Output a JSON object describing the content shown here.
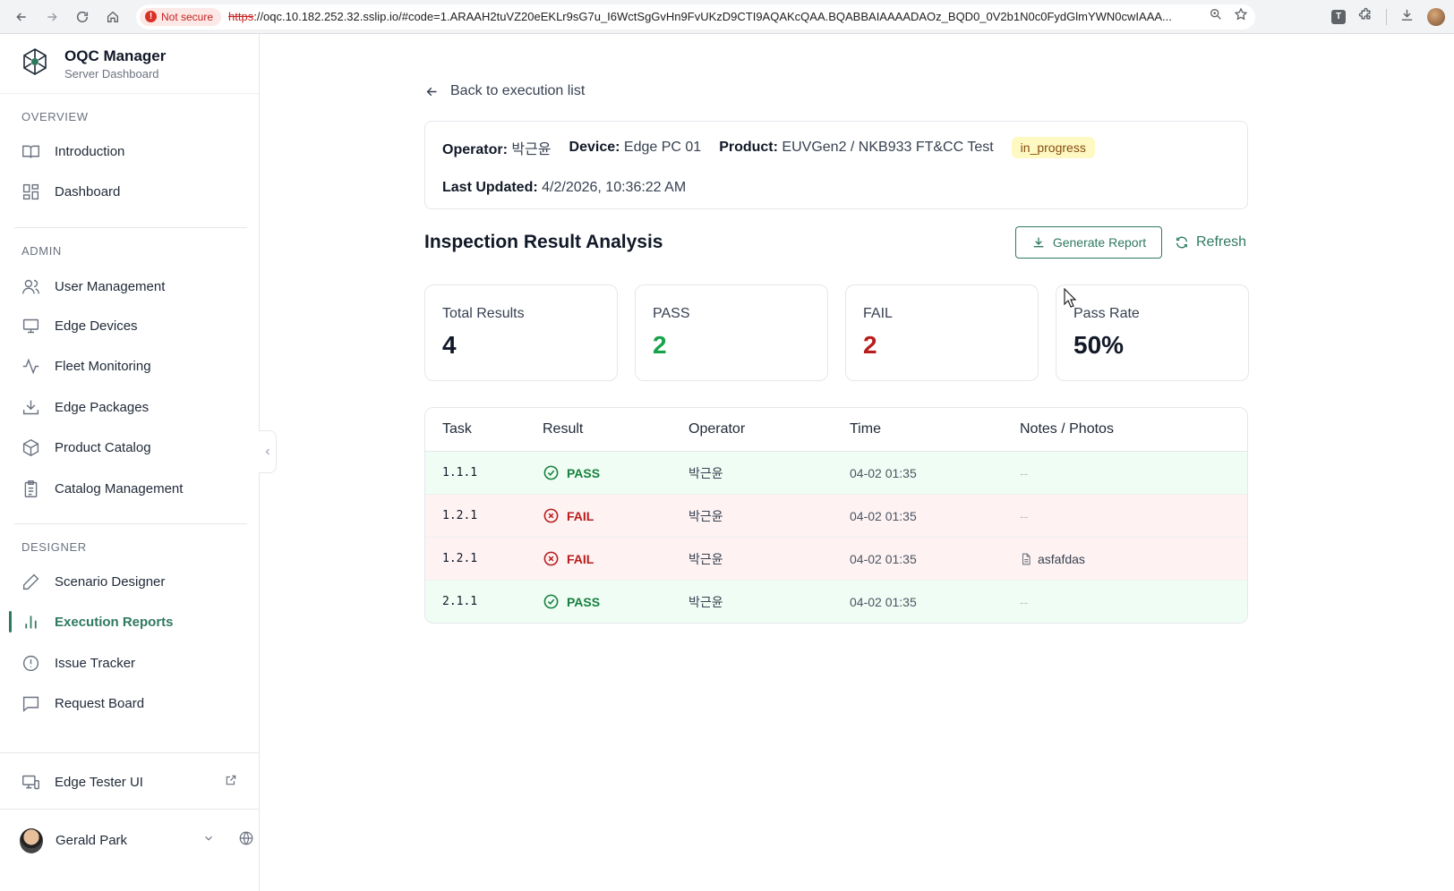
{
  "browser": {
    "not_secure_label": "Not secure",
    "url_scheme": "https",
    "url_rest": "://oqc.10.182.252.32.sslip.io/#code=1.ARAAH2tuVZ20eEKLr9sG7u_I6WctSgGvHn9FvUKzD9CTI9AQAKcQAA.BQABBAIAAAADAOz_BQD0_0V2b1N0c0FydGlmYWN0cwIAAA..."
  },
  "sidebar": {
    "brand_title": "OQC Manager",
    "brand_subtitle": "Server Dashboard",
    "sections": [
      {
        "label": "OVERVIEW",
        "items": [
          {
            "label": "Introduction",
            "icon": "book-icon"
          },
          {
            "label": "Dashboard",
            "icon": "grid-icon"
          }
        ]
      },
      {
        "label": "ADMIN",
        "items": [
          {
            "label": "User Management",
            "icon": "users-icon"
          },
          {
            "label": "Edge Devices",
            "icon": "monitor-icon"
          },
          {
            "label": "Fleet Monitoring",
            "icon": "activity-icon"
          },
          {
            "label": "Edge Packages",
            "icon": "download-tray-icon"
          },
          {
            "label": "Product Catalog",
            "icon": "box-icon"
          },
          {
            "label": "Catalog Management",
            "icon": "clipboard-icon"
          }
        ]
      },
      {
        "label": "DESIGNER",
        "items": [
          {
            "label": "Scenario Designer",
            "icon": "pencil-icon"
          },
          {
            "label": "Execution Reports",
            "icon": "bar-chart-icon",
            "active": true
          },
          {
            "label": "Issue Tracker",
            "icon": "alert-circle-icon"
          },
          {
            "label": "Request Board",
            "icon": "message-square-icon"
          }
        ]
      }
    ],
    "edge_tester_label": "Edge Tester UI",
    "user_name": "Gerald Park"
  },
  "main": {
    "back_label": "Back to execution list",
    "info": {
      "operator_label": "Operator:",
      "operator": "박근윤",
      "device_label": "Device:",
      "device": "Edge PC 01",
      "product_label": "Product:",
      "product": "EUVGen2 / NKB933 FT&CC Test",
      "status": "in_progress",
      "updated_label": "Last Updated:",
      "updated": "4/2/2026, 10:36:22 AM"
    },
    "section_title": "Inspection Result Analysis",
    "generate_report_label": "Generate Report",
    "refresh_label": "Refresh",
    "stats": [
      {
        "label": "Total Results",
        "value": "4"
      },
      {
        "label": "PASS",
        "value": "2"
      },
      {
        "label": "FAIL",
        "value": "2"
      },
      {
        "label": "Pass Rate",
        "value": "50%"
      }
    ],
    "table": {
      "headers": [
        "Task",
        "Result",
        "Operator",
        "Time",
        "Notes / Photos"
      ],
      "rows": [
        {
          "task": "1.1.1",
          "result": "PASS",
          "operator": "박근윤",
          "time": "04-02 01:35",
          "notes": "--"
        },
        {
          "task": "1.2.1",
          "result": "FAIL",
          "operator": "박근윤",
          "time": "04-02 01:35",
          "notes": "--"
        },
        {
          "task": "1.2.1",
          "result": "FAIL",
          "operator": "박근윤",
          "time": "04-02 01:35",
          "notes": "asfafdas"
        },
        {
          "task": "2.1.1",
          "result": "PASS",
          "operator": "박근윤",
          "time": "04-02 01:35",
          "notes": "--"
        }
      ]
    }
  },
  "colors": {
    "accent": "#2f7a5f",
    "pass": "#16a34a",
    "fail": "#b91c1c",
    "status_badge_bg": "#fef9c3"
  }
}
